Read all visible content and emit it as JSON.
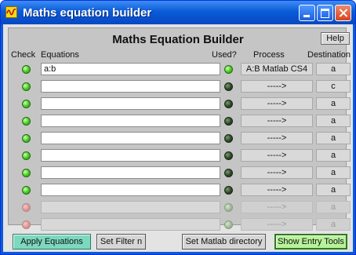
{
  "window": {
    "title": "Maths equation builder"
  },
  "panel": {
    "title": "Maths Equation Builder",
    "help_label": "Help",
    "headers": {
      "check": "Check",
      "equations": "Equations",
      "used": "Used?",
      "process": "Process",
      "destination": "Destination"
    }
  },
  "rows": [
    {
      "check": "on",
      "equation": "a:b",
      "used": "on",
      "process": "A:B Matlab CS4",
      "destination": "a",
      "enabled": true
    },
    {
      "check": "on",
      "equation": "",
      "used": "off",
      "process": "----->",
      "destination": "c",
      "enabled": true
    },
    {
      "check": "on",
      "equation": "",
      "used": "off",
      "process": "----->",
      "destination": "a",
      "enabled": true
    },
    {
      "check": "on",
      "equation": "",
      "used": "off",
      "process": "----->",
      "destination": "a",
      "enabled": true
    },
    {
      "check": "on",
      "equation": "",
      "used": "off",
      "process": "----->",
      "destination": "a",
      "enabled": true
    },
    {
      "check": "on",
      "equation": "",
      "used": "off",
      "process": "----->",
      "destination": "a",
      "enabled": true
    },
    {
      "check": "on",
      "equation": "",
      "used": "off",
      "process": "----->",
      "destination": "a",
      "enabled": true
    },
    {
      "check": "on",
      "equation": "",
      "used": "off",
      "process": "----->",
      "destination": "a",
      "enabled": true
    },
    {
      "check": "dim",
      "equation": "",
      "used": "dim",
      "process": "----->",
      "destination": "a",
      "enabled": false
    },
    {
      "check": "dim",
      "equation": "",
      "used": "dim",
      "process": "----->",
      "destination": "a",
      "enabled": false
    }
  ],
  "buttons": {
    "apply": "Apply Equations",
    "filter": "Set Filter n",
    "matlab": "Set Matlab directory",
    "entry_tools": "Show Entry Tools"
  },
  "colors": {
    "titlebar": "#0a5bd8",
    "panel_bg": "#c5c5c5",
    "led_on": "#4fd62a",
    "apply_button": "#7dd8c0",
    "entry_tools_button": "#b8f29a"
  }
}
